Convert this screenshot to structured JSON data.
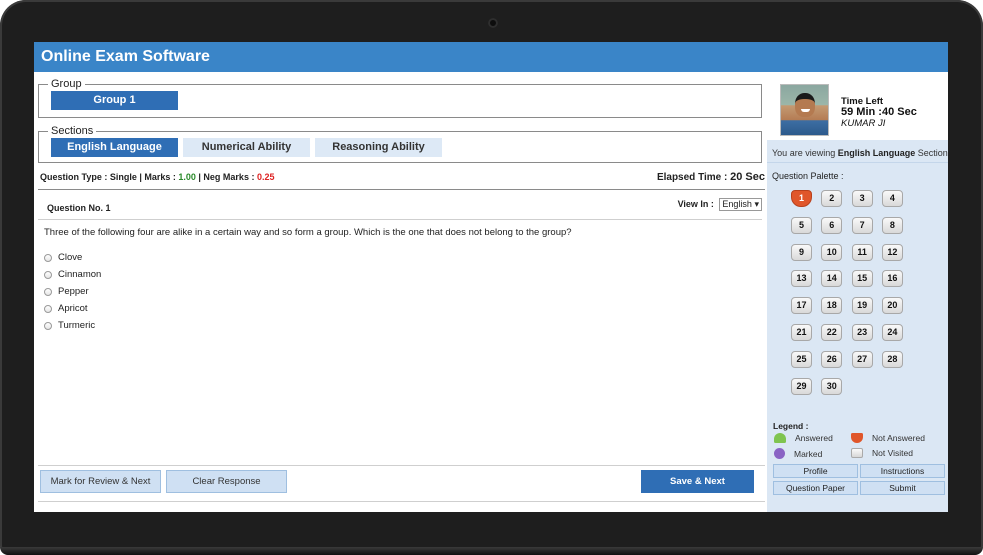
{
  "header": {
    "title": "Online Exam Software"
  },
  "group": {
    "legend": "Group",
    "tab": "Group 1"
  },
  "sections": {
    "legend": "Sections",
    "tabs": [
      {
        "label": "English Language",
        "active": true
      },
      {
        "label": "Numerical Ability",
        "active": false
      },
      {
        "label": "Reasoning Ability",
        "active": false
      }
    ]
  },
  "info": {
    "type_label": "Question Type : Single | Marks : ",
    "marks": "1.00",
    "neg_label": " | Neg Marks : ",
    "neg_marks": "0.25",
    "elapsed_label": "Elapsed Time : ",
    "elapsed_value": "20 Sec"
  },
  "question": {
    "number": "Question No. 1",
    "view_in_label": "View In :",
    "language": "English",
    "text": "Three of the following four are alike in a certain way and so form a group. Which is the one that does not belong to the group?",
    "options": [
      "Clove",
      "Cinnamon",
      "Pepper",
      "Apricot",
      "Turmeric"
    ]
  },
  "footer": {
    "review_label": "Mark for Review & Next",
    "clear_label": "Clear Response",
    "save_label": "Save & Next"
  },
  "candidate": {
    "time_left_label": "Time Left",
    "time_left_value": "59 Min :40 Sec",
    "name": "KUMAR JI"
  },
  "viewing": {
    "prefix": "You are viewing ",
    "section": "English Language",
    "suffix": " Section"
  },
  "palette": {
    "label": "Question Palette :",
    "numbers": [
      "1",
      "2",
      "3",
      "4",
      "5",
      "6",
      "7",
      "8",
      "9",
      "10",
      "11",
      "12",
      "13",
      "14",
      "15",
      "16",
      "17",
      "18",
      "19",
      "20",
      "21",
      "22",
      "23",
      "24",
      "25",
      "26",
      "27",
      "28",
      "29",
      "30"
    ],
    "not_answered": [
      "1"
    ]
  },
  "legend": {
    "title": "Legend :",
    "answered": "Answered",
    "not_answered": "Not Answered",
    "marked": "Marked",
    "not_visited": "Not Visited"
  },
  "panel_buttons": {
    "profile": "Profile",
    "instructions": "Instructions",
    "question_paper": "Question Paper",
    "submit": "Submit"
  },
  "colors": {
    "header": "#3a85c8",
    "accent": "#2f6eb5",
    "not_answered": "#e0562a",
    "answered": "#7fc44f",
    "marked": "#8a63c4"
  }
}
